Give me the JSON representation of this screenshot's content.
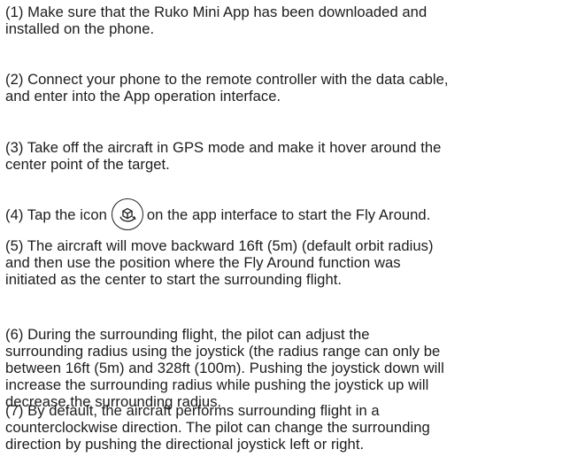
{
  "steps": [
    {
      "lines": [
        "(1) Make sure that the Ruko Mini App has been downloaded and",
        "installed on the phone."
      ]
    },
    {
      "lines": [
        "(2) Connect your phone to the remote controller with the data cable,",
        "and enter into the App operation interface."
      ]
    },
    {
      "lines": [
        "(3) Take off the aircraft in GPS mode and make it hover around the",
        "center point of the target."
      ]
    },
    {
      "before_icon": "(4) Tap the icon",
      "icon": "fly-around-icon",
      "after_icon": "on the app interface to start the Fly Around."
    },
    {
      "lines": [
        "(5) The aircraft will move backward 16ft (5m) (default orbit radius)",
        "and then use the position where the Fly Around function was",
        "initiated as the center to start the surrounding flight."
      ]
    },
    {
      "lines": [
        "(6) During the surrounding flight, the pilot can adjust the",
        "surrounding radius using the joystick (the radius range can only be",
        "between 16ft (5m) and 328ft (100m). Pushing the joystick down will",
        "increase the surrounding radius while pushing the joystick up will",
        "decrease the surrounding radius."
      ]
    },
    {
      "lines": [
        "(7) By default, the aircraft performs surrounding flight in a",
        "counterclockwise direction. The pilot can change the surrounding",
        "direction by pushing the directional joystick left or right."
      ]
    }
  ]
}
